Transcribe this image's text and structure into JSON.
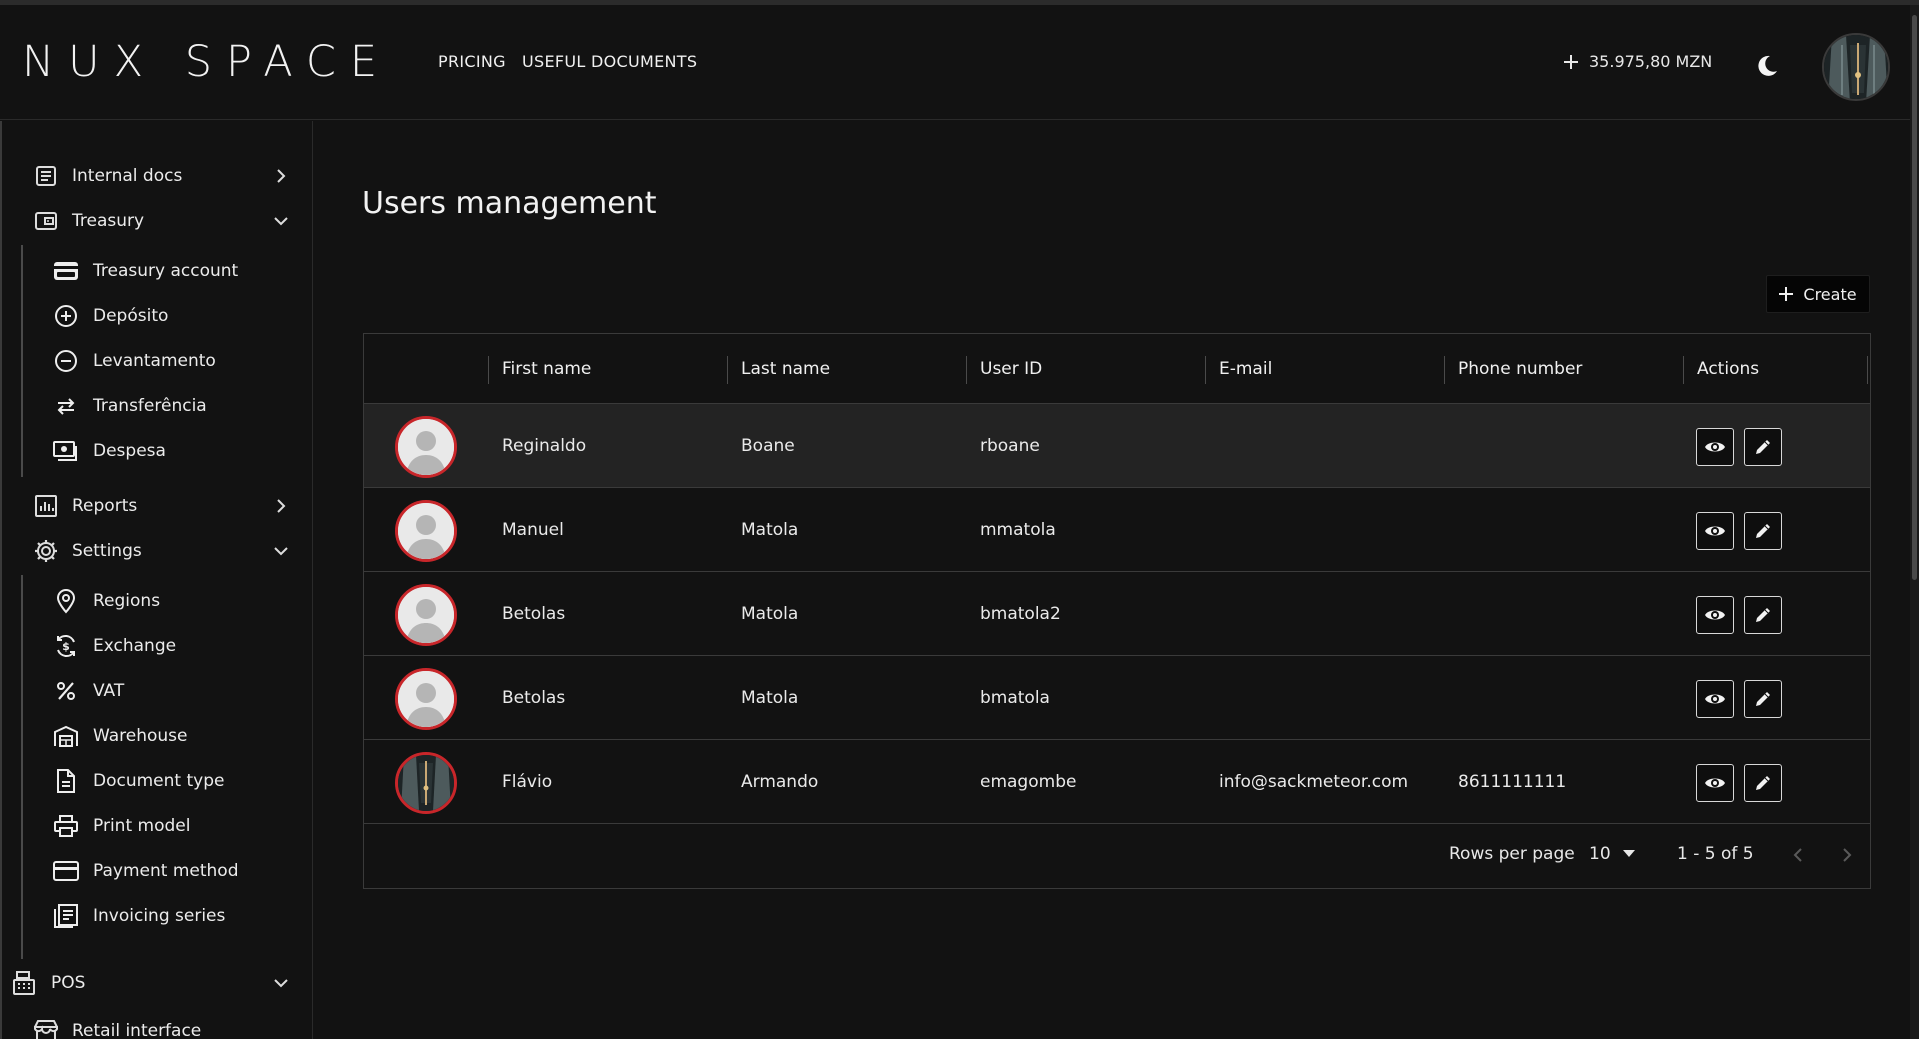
{
  "app": {
    "logo_text": "NUX SPACE"
  },
  "header": {
    "nav": [
      "PRICING",
      "USEFUL DOCUMENTS"
    ],
    "balance": "35.975,80 MZN",
    "theme_icon": "moon-icon",
    "avatar_icon": "user-avatar"
  },
  "sidebar": {
    "items": [
      {
        "label": "Internal docs",
        "icon": "document-icon",
        "chevron": "right"
      },
      {
        "label": "Treasury",
        "icon": "wallet-icon",
        "chevron": "down"
      },
      {
        "label": "Treasury account",
        "icon": "card-icon"
      },
      {
        "label": "Depósito",
        "icon": "plus-circle-icon"
      },
      {
        "label": "Levantamento",
        "icon": "minus-circle-icon"
      },
      {
        "label": "Transferência",
        "icon": "swap-icon"
      },
      {
        "label": "Despesa",
        "icon": "cash-icon"
      },
      {
        "label": "Reports",
        "icon": "chart-icon",
        "chevron": "right"
      },
      {
        "label": "Settings",
        "icon": "gear-icon",
        "chevron": "down"
      },
      {
        "label": "Regions",
        "icon": "map-pin-icon"
      },
      {
        "label": "Exchange",
        "icon": "exchange-icon"
      },
      {
        "label": "VAT",
        "icon": "percent-icon"
      },
      {
        "label": "Warehouse",
        "icon": "warehouse-icon"
      },
      {
        "label": "Document type",
        "icon": "file-icon"
      },
      {
        "label": "Print model",
        "icon": "printer-icon"
      },
      {
        "label": "Payment method",
        "icon": "credit-card-icon"
      },
      {
        "label": "Invoicing series",
        "icon": "list-icon"
      },
      {
        "label": "POS",
        "icon": "register-icon",
        "chevron": "down"
      },
      {
        "label": "Retail interface",
        "icon": "store-icon"
      }
    ]
  },
  "main": {
    "title": "Users management",
    "create_label": "Create",
    "table": {
      "headers": [
        "First name",
        "Last name",
        "User ID",
        "E-mail",
        "Phone number",
        "Actions"
      ],
      "rows": [
        {
          "first": "Reginaldo",
          "last": "Boane",
          "user_id": "rboane",
          "email": "",
          "phone": "",
          "avatar": "default"
        },
        {
          "first": "Manuel",
          "last": "Matola",
          "user_id": "mmatola",
          "email": "",
          "phone": "",
          "avatar": "default"
        },
        {
          "first": "Betolas",
          "last": "Matola",
          "user_id": "bmatola2",
          "email": "",
          "phone": "",
          "avatar": "default"
        },
        {
          "first": "Betolas",
          "last": "Matola",
          "user_id": "bmatola",
          "email": "",
          "phone": "",
          "avatar": "default"
        },
        {
          "first": "Flávio",
          "last": "Armando",
          "user_id": "emagombe",
          "email": "info@sackmeteor.com",
          "phone": "8611111111",
          "avatar": "photo"
        }
      ]
    },
    "pagination": {
      "rows_per_page_label": "Rows per page",
      "rows_per_page": "10",
      "range": "1 - 5 of 5"
    }
  },
  "colors": {
    "background": "#121212",
    "avatar_ring": "#c8262a",
    "highlight_row": "#232323"
  }
}
